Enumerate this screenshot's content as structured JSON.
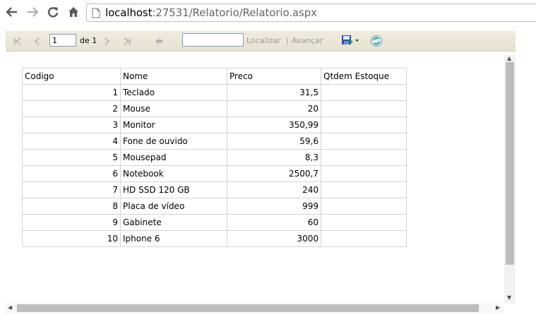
{
  "browser": {
    "url_host": "localhost",
    "url_rest": ":27531/Relatorio/Relatorio.aspx"
  },
  "toolbar": {
    "page_value": "1",
    "of_label": "de 1",
    "find_placeholder": "",
    "find_label": "Localizar",
    "separator": "|",
    "next_label": "Avançar"
  },
  "table": {
    "headers": [
      "Codigo",
      "Nome",
      "Preco",
      "Qtdem Estoque"
    ],
    "rows": [
      [
        "1",
        "Teclado",
        "31,5",
        ""
      ],
      [
        "2",
        "Mouse",
        "20",
        ""
      ],
      [
        "3",
        "Monitor",
        "350,99",
        ""
      ],
      [
        "4",
        "Fone de ouvido",
        "59,6",
        ""
      ],
      [
        "5",
        "Mousepad",
        "8,3",
        ""
      ],
      [
        "6",
        "Notebook",
        "2500,7",
        ""
      ],
      [
        "7",
        "HD SSD 120 GB",
        "240",
        ""
      ],
      [
        "8",
        "Placa de vídeo",
        "999",
        ""
      ],
      [
        "9",
        "Gabinete",
        "60",
        ""
      ],
      [
        "10",
        "Iphone 6",
        "3000",
        ""
      ]
    ]
  },
  "colors": {
    "toolbar_bg": "#ece8da",
    "grid_border": "#d3d3d3",
    "link_gray": "#9a9a9a"
  }
}
